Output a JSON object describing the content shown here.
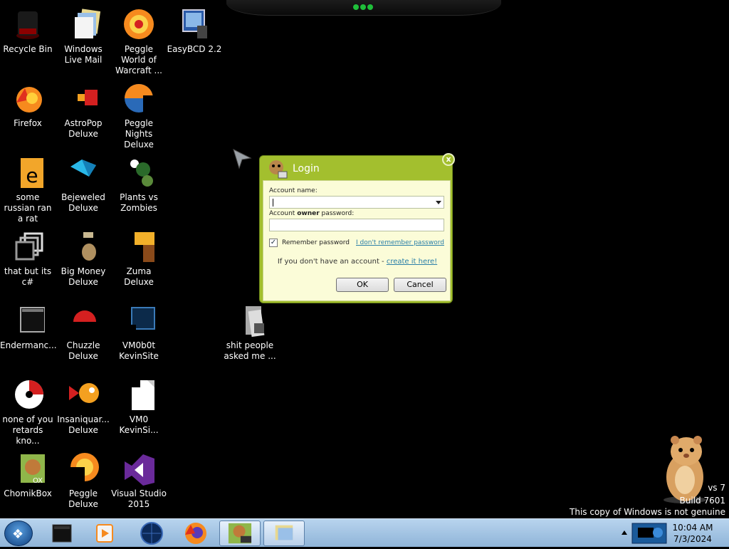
{
  "desktop": {
    "icons": [
      {
        "label": "Recycle Bin",
        "icon": "recycle-bin-icon"
      },
      {
        "label": "Windows Live Mail",
        "icon": "mail-icon"
      },
      {
        "label": "Peggle World of Warcraft ...",
        "icon": "peggle-icon"
      },
      {
        "label": "EasyBCD 2.2",
        "icon": "easybcd-icon"
      },
      {
        "label": "Firefox",
        "icon": "firefox-icon"
      },
      {
        "label": "AstroPop Deluxe",
        "icon": "astropop-icon"
      },
      {
        "label": "Peggle Nights Deluxe",
        "icon": "peggle-nights-icon"
      },
      {
        "label": "some russian ran a rat",
        "icon": "document-icon"
      },
      {
        "label": "Bejeweled Deluxe",
        "icon": "bejeweled-icon"
      },
      {
        "label": "Plants vs Zombies",
        "icon": "plants-icon"
      },
      {
        "label": "that but its c#",
        "icon": "shortcut-icon"
      },
      {
        "label": "Big Money Deluxe",
        "icon": "money-icon"
      },
      {
        "label": "Zuma Deluxe",
        "icon": "zuma-icon"
      },
      {
        "label": "Endermanc...",
        "icon": "terminal-icon"
      },
      {
        "label": "Chuzzle Deluxe",
        "icon": "chuzzle-icon"
      },
      {
        "label": "VM0b0t KevinSite",
        "icon": "vm-icon"
      },
      {
        "label": "shit people asked me ...",
        "icon": "folder-icon"
      },
      {
        "label": "none of you retards kno...",
        "icon": "disc-icon"
      },
      {
        "label": "Insaniquar... Deluxe",
        "icon": "fish-icon"
      },
      {
        "label": "VM0 KevinSi...",
        "icon": "file-icon"
      },
      {
        "label": "ChomikBox",
        "icon": "chomikbox-icon"
      },
      {
        "label": "Peggle Deluxe",
        "icon": "peggle-deluxe-icon"
      },
      {
        "label": "Visual Studio 2015",
        "icon": "visual-studio-icon"
      }
    ]
  },
  "login": {
    "title": "Login",
    "close_label": "x",
    "account_name_label": "Account name:",
    "password_label_prefix": "Account ",
    "password_label_bold": "owner",
    "password_label_suffix": " password:",
    "account_name_value": "",
    "password_value": "",
    "remember_label": "Remember password",
    "remember_checked": true,
    "forgot_link": "I don't remember password",
    "no_account_text": "If you don't have an account - ",
    "create_link": "create it here!",
    "ok_label": "OK",
    "cancel_label": "Cancel"
  },
  "watermark": {
    "line1": "vs 7",
    "line2": "Build 7601",
    "line3": "This copy of Windows is not genuine"
  },
  "taskbar": {
    "clock_time": "10:04 AM",
    "clock_date": "7/3/2024"
  },
  "colors": {
    "login_frame": "#a3bf2e",
    "login_panel": "#fbfcd8",
    "link": "#2a7fa8",
    "taskbar": "#a6c6e4"
  }
}
